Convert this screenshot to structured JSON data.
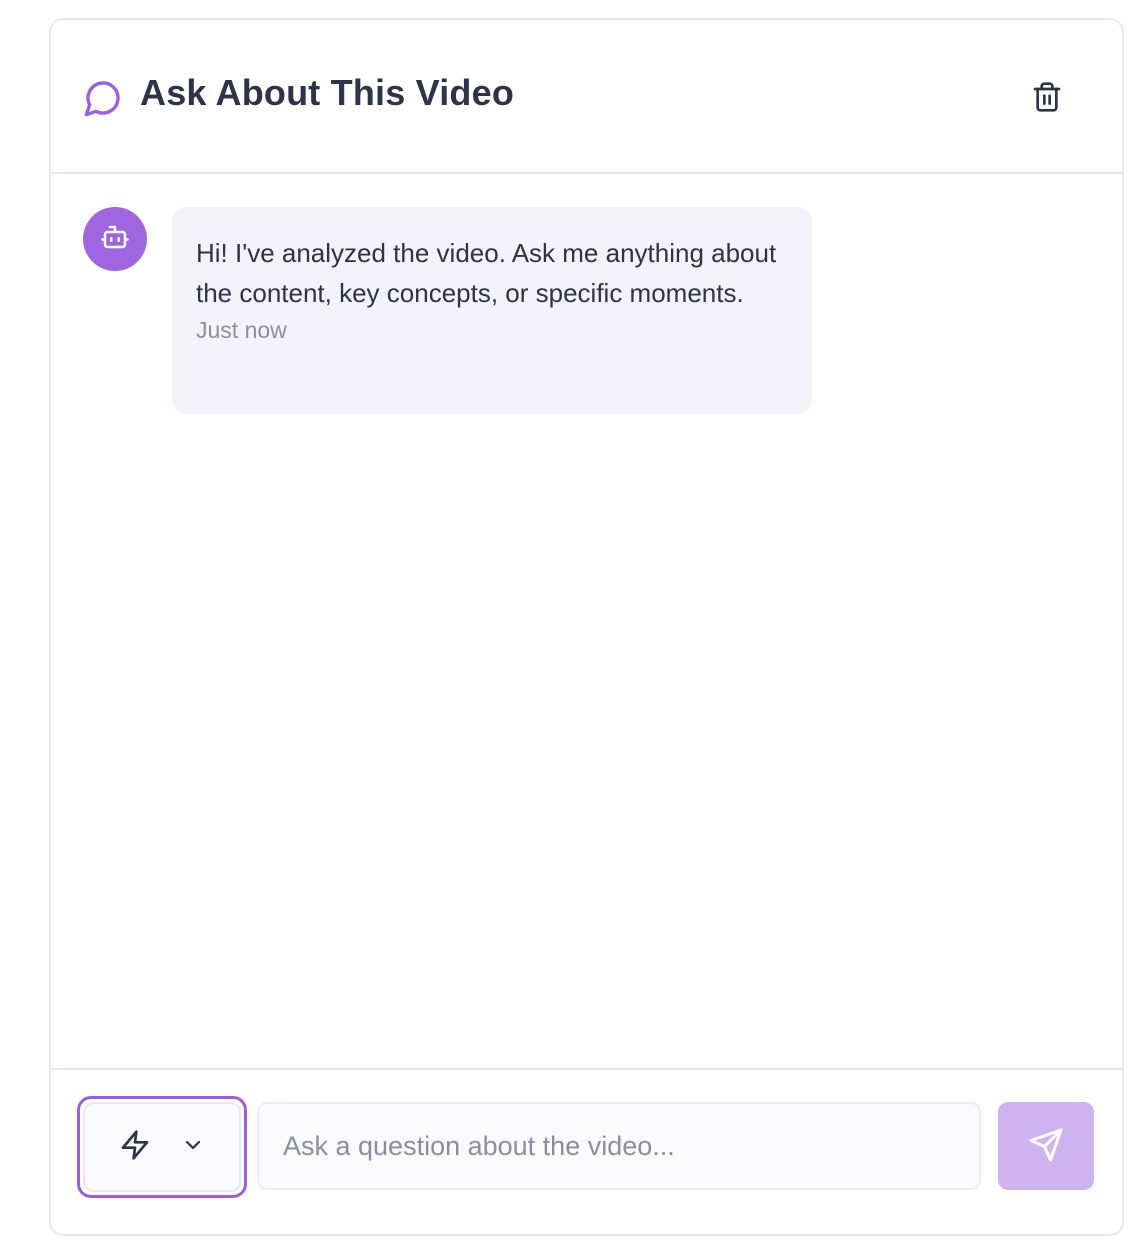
{
  "header": {
    "title": "Ask About This Video",
    "icon": "chat-bubble-icon",
    "delete_icon": "trash-icon"
  },
  "messages": [
    {
      "sender": "assistant",
      "avatar_icon": "bot-icon",
      "text": "Hi! I've analyzed the video. Ask me anything about the content, key concepts, or specific moments.",
      "time": "Just now"
    }
  ],
  "composer": {
    "mode_icon": "lightning-icon",
    "mode_dropdown_icon": "chevron-down-icon",
    "input_value": "",
    "input_placeholder": "Ask a question about the video...",
    "send_icon": "send-icon"
  },
  "colors": {
    "accent": "#9b5de5",
    "avatar_bg": "#a066e0",
    "bubble_bg": "#f4f3fb",
    "send_disabled_bg": "#cfb3f1",
    "text": "#2d3348",
    "muted": "#8a8fa0",
    "border": "#e8e8f0"
  }
}
